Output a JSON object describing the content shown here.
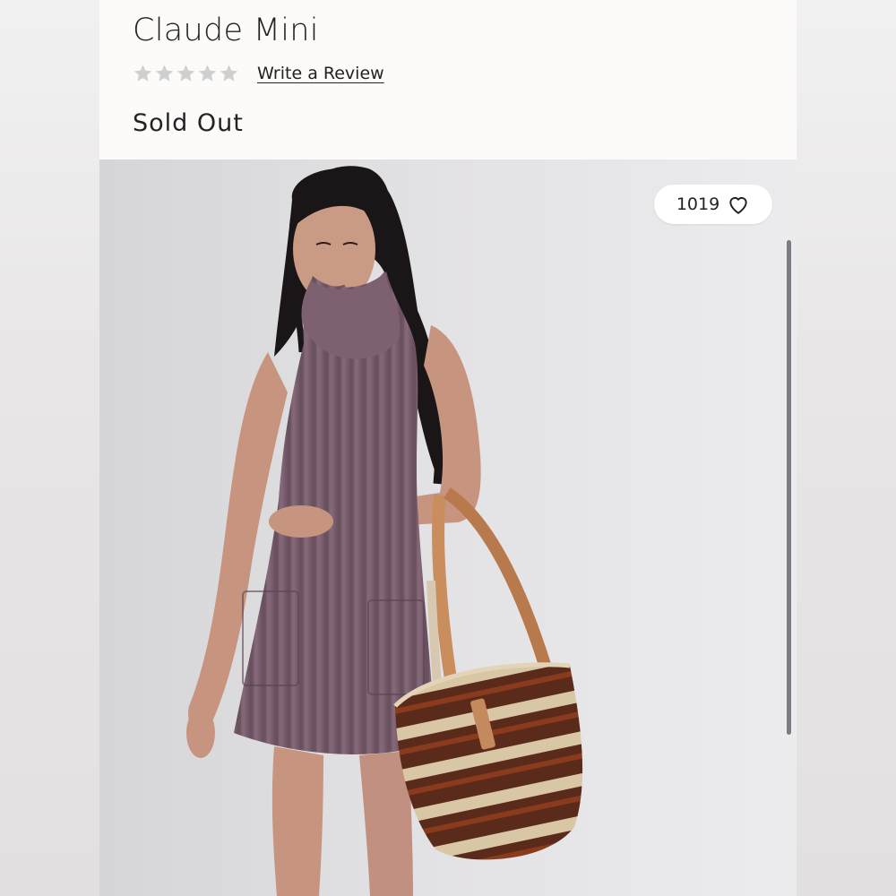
{
  "product": {
    "title": "Claude Mini",
    "rating": {
      "value": 0,
      "max": 5
    },
    "review_link_label": "Write a Review",
    "availability": "Sold Out"
  },
  "image": {
    "like_count": "1019",
    "like_icon": "heart-outline-icon",
    "alt": "Model wearing a purple ribbed sleeveless turtleneck mini sweater dress, holding a striped woven tote with leather handles"
  },
  "colors": {
    "text": "#222222",
    "star_empty": "#cccccc",
    "dress": "#7e6470",
    "header_bg": "#fdfbfa"
  }
}
